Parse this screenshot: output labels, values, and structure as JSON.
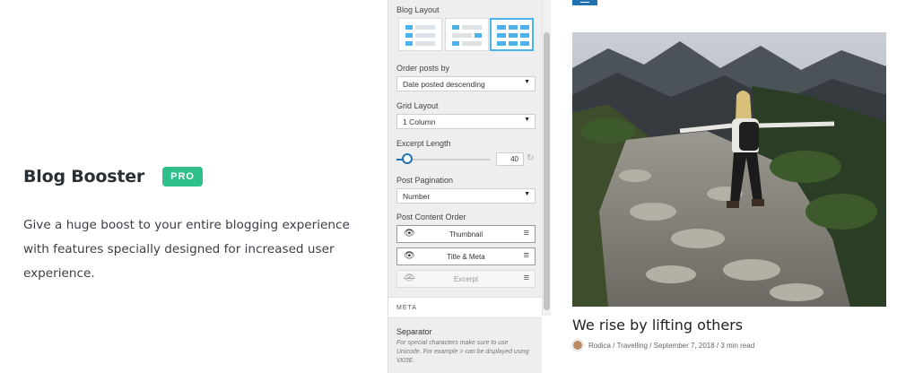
{
  "hero": {
    "title": "Blog Booster",
    "badge": "PRO",
    "description": "Give a huge boost to your entire blogging experience with features specially designed for increased user experience."
  },
  "panel": {
    "blog_layout_label": "Blog Layout",
    "order_label": "Order posts by",
    "order_value": "Date posted descending",
    "grid_label": "Grid Layout",
    "grid_value": "1 Column",
    "excerpt_label": "Excerpt Length",
    "excerpt_value": "40",
    "excerpt_fraction": 0.12,
    "pagination_label": "Post Pagination",
    "pagination_value": "Number",
    "content_order_label": "Post Content Order",
    "content_items": [
      {
        "label": "Thumbnail",
        "visible": true
      },
      {
        "label": "Title & Meta",
        "visible": true
      },
      {
        "label": "Excerpt",
        "visible": false
      }
    ],
    "meta_section": "META",
    "separator_label": "Separator",
    "separator_desc": "For special characters make sure to use Unicode. For example > can be displayed using \\003E."
  },
  "preview": {
    "post_title": "We rise by lifting others",
    "author": "Rodica",
    "category": "Travelling",
    "date": "September 7, 2018",
    "read_time": "3 min read"
  },
  "colors": {
    "accent": "#2271b1",
    "badge": "#2fbf8a",
    "layout_active": "#4db2ec"
  }
}
